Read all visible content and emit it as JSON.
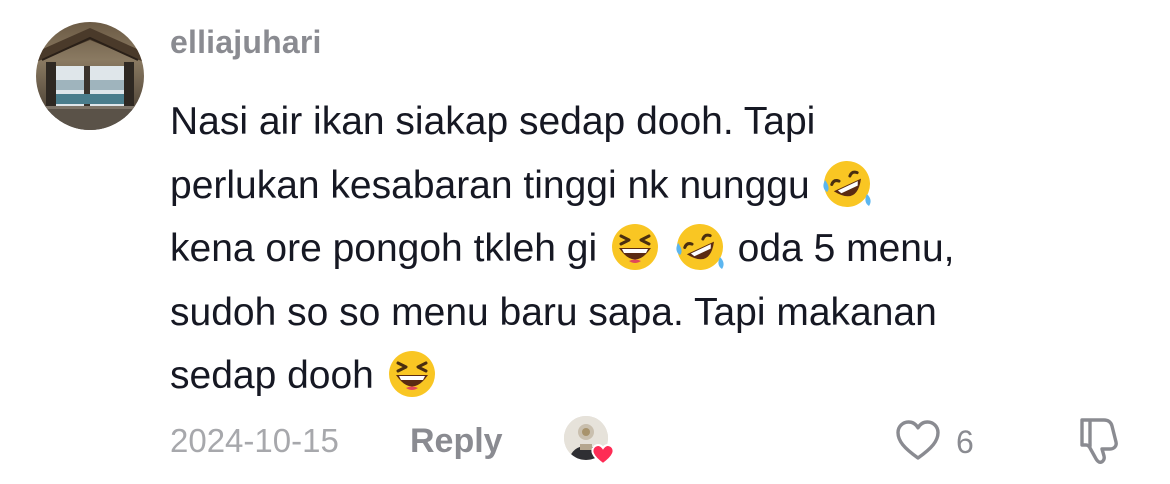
{
  "comment": {
    "username": "elliajuhari",
    "lines": [
      [
        "Nasi air ikan siakap sedap dooh. Tapi"
      ],
      [
        "perlukan kesabaran tinggi nk nunggu ",
        "rofl-emoji"
      ],
      [
        "kena ore pongoh tkleh gi ",
        "laughing-emoji",
        " ",
        "rofl-emoji",
        " oda 5 menu,"
      ],
      [
        "sudoh so so menu baru sapa. Tapi makanan"
      ],
      [
        "sedap dooh ",
        "laughing-emoji"
      ]
    ],
    "date": "2024-10-15",
    "reply_label": "Reply",
    "like_count": "6"
  },
  "icons": {
    "like": "heart-outline-icon",
    "dislike": "thumbs-down-icon",
    "creator_liked": "creator-liked-heart-icon"
  },
  "colors": {
    "username": "#8a8b91",
    "text": "#161823",
    "meta": "#a7a8ac",
    "heart": "#fe2c55",
    "emoji_face": "#f9c623"
  }
}
